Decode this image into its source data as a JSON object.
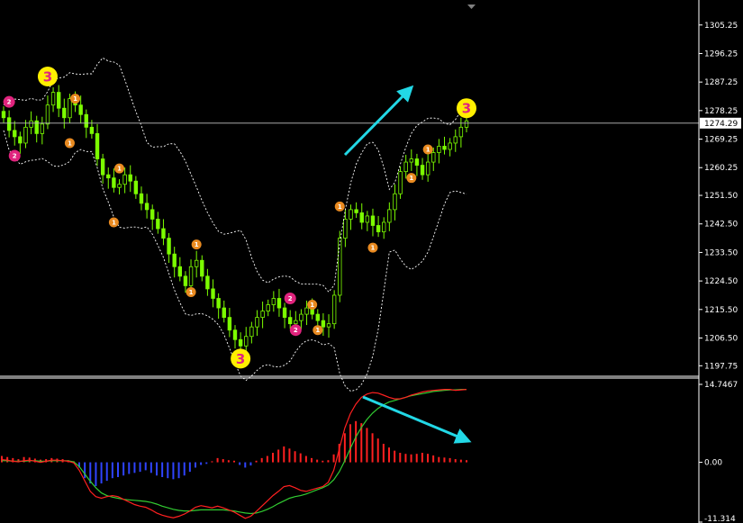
{
  "chart_data": [
    {
      "panel": "price",
      "type": "candlestick",
      "y_ticks": [
        "1305.25",
        "1296.25",
        "1287.25",
        "1278.25",
        "1269.25",
        "1260.25",
        "1251.50",
        "1242.50",
        "1233.50",
        "1224.50",
        "1215.50",
        "1206.50",
        "1197.75"
      ],
      "ylim": [
        1195,
        1312
      ],
      "current_price": "1274.29",
      "grid": false,
      "colors": {
        "candles": "#7CFC00",
        "bands": "#ffffff",
        "arrow": "#22d8e6",
        "badge3": "#ffef00",
        "label_pink": "#e0237d",
        "label_orange": "#e98a20"
      },
      "close_series": [
        1276,
        1272,
        1270,
        1268,
        1273,
        1275,
        1271,
        1274,
        1280,
        1284,
        1279,
        1276,
        1282,
        1280,
        1277,
        1273,
        1271,
        1263,
        1258,
        1257,
        1254,
        1255,
        1258,
        1256,
        1252,
        1249,
        1247,
        1244,
        1241,
        1238,
        1233,
        1229,
        1226,
        1223,
        1229,
        1231,
        1226,
        1222,
        1219,
        1216,
        1213,
        1209,
        1206,
        1204,
        1207,
        1210,
        1213,
        1215,
        1217,
        1219,
        1216,
        1213,
        1211,
        1212,
        1214,
        1216,
        1214,
        1212,
        1210,
        1211,
        1220,
        1238,
        1244,
        1247,
        1246,
        1243,
        1245,
        1242,
        1240,
        1243,
        1247,
        1252,
        1259,
        1262,
        1263,
        1261,
        1258,
        1262,
        1265,
        1267,
        1266,
        1268,
        1270,
        1273,
        1275
      ],
      "labels": [
        {
          "text": "3",
          "style": "badge3",
          "index": 8,
          "y": 1289
        },
        {
          "text": "3",
          "style": "badge3",
          "index": 43,
          "y": 1200
        },
        {
          "text": "3",
          "style": "badge3",
          "index": 84,
          "y": 1279
        },
        {
          "text": "2",
          "style": "pink",
          "index": 1,
          "y": 1281
        },
        {
          "text": "2",
          "style": "pink",
          "index": 2,
          "y": 1264
        },
        {
          "text": "2",
          "style": "pink",
          "index": 52,
          "y": 1219
        },
        {
          "text": "2",
          "style": "pink",
          "index": 53,
          "y": 1209
        },
        {
          "text": "1",
          "style": "orange",
          "index": 13,
          "y": 1282
        },
        {
          "text": "1",
          "style": "orange",
          "index": 12,
          "y": 1268
        },
        {
          "text": "1",
          "style": "orange",
          "index": 21,
          "y": 1260
        },
        {
          "text": "1",
          "style": "orange",
          "index": 20,
          "y": 1243
        },
        {
          "text": "1",
          "style": "orange",
          "index": 35,
          "y": 1236
        },
        {
          "text": "1",
          "style": "orange",
          "index": 34,
          "y": 1221
        },
        {
          "text": "1",
          "style": "orange",
          "index": 56,
          "y": 1217
        },
        {
          "text": "1",
          "style": "orange",
          "index": 57,
          "y": 1209
        },
        {
          "text": "1",
          "style": "orange",
          "index": 61,
          "y": 1248
        },
        {
          "text": "1",
          "style": "orange",
          "index": 67,
          "y": 1235
        },
        {
          "text": "1",
          "style": "orange",
          "index": 77,
          "y": 1266
        },
        {
          "text": "1",
          "style": "orange",
          "index": 74,
          "y": 1257
        }
      ]
    },
    {
      "panel": "macd",
      "type": "histogram+lines",
      "y_ticks": [
        "14.7467",
        "0.00",
        "-11.314"
      ],
      "ylim": [
        -11.314,
        14.7467
      ],
      "colors": {
        "positive": "#ff2020",
        "negative": "#2f44ff",
        "main_line": "#ff2020",
        "signal_line": "#32cd32",
        "arrow": "#22d8e6"
      },
      "histogram": [
        1.2,
        1.0,
        0.8,
        0.6,
        1.0,
        0.9,
        0.7,
        0.5,
        0.6,
        0.8,
        0.7,
        0.6,
        0.4,
        0.2,
        -1,
        -3,
        -4,
        -4.5,
        -4,
        -3.5,
        -3,
        -2.8,
        -2.5,
        -2.2,
        -2,
        -1.8,
        -1.5,
        -2,
        -2.5,
        -2.8,
        -3,
        -3.2,
        -3,
        -2.5,
        -1.8,
        -1,
        -0.5,
        -0.3,
        0.2,
        0.8,
        0.6,
        0.4,
        0.3,
        -0.5,
        -1,
        -0.6,
        0.3,
        0.8,
        1.2,
        1.8,
        2.4,
        3.0,
        2.6,
        2.1,
        1.7,
        1.2,
        0.8,
        0.5,
        0.3,
        0.4,
        1.5,
        3.5,
        5.5,
        7.2,
        7.8,
        7.4,
        6.5,
        5.5,
        4.5,
        3.5,
        2.8,
        2.2,
        1.8,
        1.6,
        1.5,
        1.6,
        1.8,
        1.6,
        1.3,
        1.0,
        0.9,
        0.8,
        0.6,
        0.5,
        0.4
      ],
      "main_line": [
        0.5,
        0.4,
        0.2,
        0.1,
        0.3,
        0.4,
        0.2,
        0.0,
        0.2,
        0.4,
        0.4,
        0.3,
        0.2,
        -0.1,
        -1.5,
        -3.5,
        -5.5,
        -6.5,
        -6.8,
        -6.5,
        -6.3,
        -6.5,
        -7,
        -7.5,
        -8,
        -8.3,
        -8.5,
        -9,
        -9.6,
        -10,
        -10.3,
        -10.5,
        -10.2,
        -9.8,
        -9.2,
        -8.5,
        -8.2,
        -8.4,
        -8.6,
        -8.3,
        -8.6,
        -9,
        -9.4,
        -10,
        -10.6,
        -10.2,
        -9.3,
        -8.3,
        -7.3,
        -6.3,
        -5.5,
        -4.6,
        -4.4,
        -4.8,
        -5.3,
        -5.5,
        -5.2,
        -4.9,
        -4.6,
        -3.8,
        -1.5,
        2.5,
        6.5,
        9.2,
        11,
        12.3,
        12.9,
        13.2,
        13.1,
        12.7,
        12.3,
        12.0,
        12.0,
        12.3,
        12.7,
        13.0,
        13.3,
        13.5,
        13.6,
        13.7,
        13.8,
        13.8,
        13.6,
        13.7,
        13.8
      ],
      "signal_line": [
        0.3,
        0.3,
        0.2,
        0.2,
        0.2,
        0.3,
        0.3,
        0.2,
        0.2,
        0.3,
        0.3,
        0.3,
        0.3,
        0.1,
        -0.8,
        -2.2,
        -3.6,
        -4.8,
        -5.8,
        -6.3,
        -6.6,
        -6.8,
        -7.0,
        -7.1,
        -7.2,
        -7.3,
        -7.4,
        -7.6,
        -7.9,
        -8.3,
        -8.6,
        -8.9,
        -9.1,
        -9.2,
        -9.2,
        -9.1,
        -9.0,
        -9.0,
        -9.0,
        -9.0,
        -9.0,
        -9.1,
        -9.2,
        -9.4,
        -9.6,
        -9.7,
        -9.6,
        -9.3,
        -8.9,
        -8.4,
        -7.8,
        -7.3,
        -6.8,
        -6.5,
        -6.3,
        -6.0,
        -5.6,
        -5.2,
        -4.8,
        -4.3,
        -3.3,
        -1.8,
        0.3,
        2.6,
        4.8,
        6.6,
        8.1,
        9.3,
        10.2,
        10.9,
        11.4,
        11.7,
        12.0,
        12.3,
        12.6,
        12.8,
        13.0,
        13.2,
        13.4,
        13.5,
        13.6,
        13.7,
        13.7,
        13.8,
        13.8
      ]
    }
  ]
}
